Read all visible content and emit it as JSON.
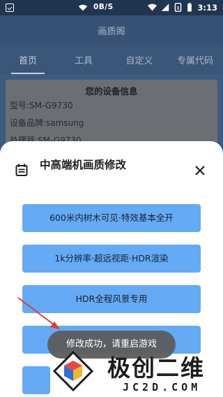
{
  "status_bar": {
    "speed": "0B/S",
    "battery": "1",
    "time": "3:13"
  },
  "app_bar": {
    "title": "画质阁"
  },
  "tabs": [
    {
      "label": "首页",
      "active": true
    },
    {
      "label": "工具",
      "active": false
    },
    {
      "label": "自定义",
      "active": false
    },
    {
      "label": "专属代码",
      "active": false
    }
  ],
  "device_card": {
    "title": "您的设备信息",
    "model": "型号:SM-G9730",
    "brand": "设备品牌:samsung",
    "processor": "处理器:SM-G9730"
  },
  "sheet": {
    "title": "中高端机画质修改",
    "options": [
      "600米内树木可见·特效基本全开",
      "1k分辨率·超远视距·HDR渲染",
      "HDR全程风景专用"
    ]
  },
  "toast": {
    "text": "修改成功，请重启游戏"
  },
  "watermark": {
    "name": "极创二维",
    "domain": "JC2D.COM"
  },
  "colors": {
    "accent": "#64aaf5",
    "appbar": "#375275",
    "arrow": "#e03a2f"
  }
}
